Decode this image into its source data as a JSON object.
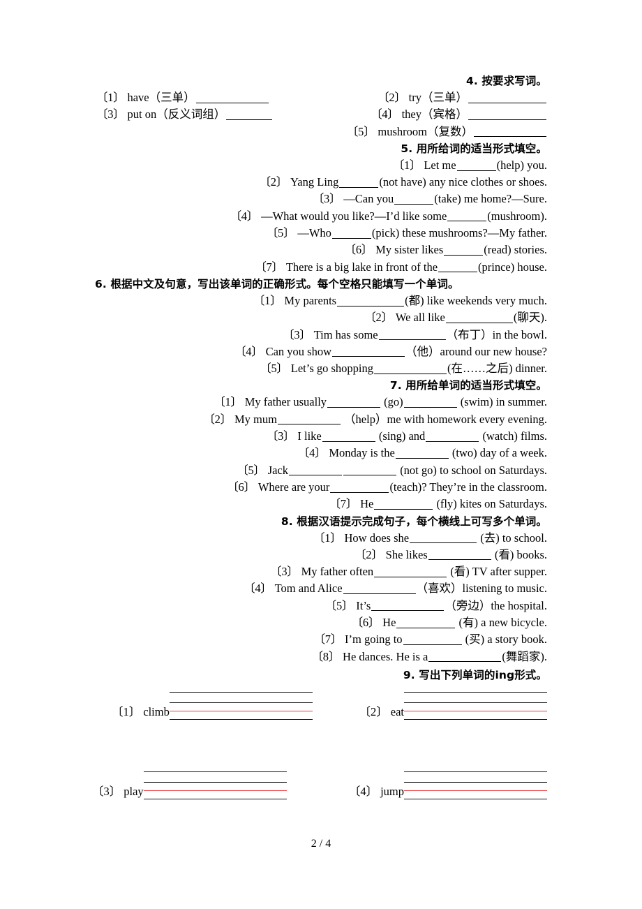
{
  "document": {
    "page_label": "2 / 4",
    "page_number": 2,
    "total_pages": 4
  },
  "sections": [
    {
      "id": "ex4",
      "heading": "4. 按要求写词。",
      "layout": "two-column",
      "items": [
        {
          "index": "〔1〕",
          "text": "have（三单）",
          "blank_width": "w104"
        },
        {
          "index": "〔2〕",
          "text": "try（三单）",
          "blank_width": "w112"
        },
        {
          "index": "〔3〕",
          "text": "put on（反义词组）",
          "blank_width": "w66"
        },
        {
          "index": "〔4〕",
          "text": "they（宾格）",
          "blank_width": "w112"
        },
        {
          "index": "〔5〕",
          "text": "mushroom（复数）",
          "blank_width": "w104"
        }
      ]
    },
    {
      "id": "ex5",
      "heading": "5. 用所给词的适当形式填空。",
      "layout": "right-aligned",
      "items": [
        {
          "index": "〔1〕",
          "before": "Let me",
          "blank_width": "w56",
          "after": "(help) you."
        },
        {
          "index": "〔2〕",
          "before": "Yang Ling",
          "blank_width": "w56",
          "after": "(not have) any nice clothes or shoes."
        },
        {
          "index": "〔3〕",
          "before": "—Can you",
          "blank_width": "w56",
          "after": "(take) me home?—Sure."
        },
        {
          "index": "〔4〕",
          "before": "—What would you like?—I’d like some",
          "blank_width": "w56",
          "after": "(mushroom)."
        },
        {
          "index": "〔5〕",
          "before": "—Who",
          "blank_width": "w56",
          "after": "(pick) these mushrooms?—My father."
        },
        {
          "index": "〔6〕",
          "before": "My sister likes",
          "blank_width": "w56",
          "after": "(read) stories."
        },
        {
          "index": "〔7〕",
          "before": "There is a big lake in front of the",
          "blank_width": "w56",
          "after": "(prince) house."
        }
      ]
    },
    {
      "id": "ex6",
      "heading": "6. 根据中文及句意，写出该单词的正确形式。每个空格只能填写一个单词。",
      "heading_align": "left",
      "layout": "right-aligned",
      "items": [
        {
          "index": "〔1〕",
          "before": "My parents",
          "blank_width": "w96",
          "after": "(都) like weekends very much."
        },
        {
          "index": "〔2〕",
          "before": "We all like",
          "blank_width": "w96",
          "after": "(聊天)."
        },
        {
          "index": "〔3〕",
          "before": "Tim has some",
          "blank_width": "w96",
          "after": "（布丁）in the bowl."
        },
        {
          "index": "〔4〕",
          "before": "Can you show",
          "blank_width": "w104",
          "after": "（他）around our new house?"
        },
        {
          "index": "〔5〕",
          "before": "Let’s go shopping",
          "blank_width": "w104",
          "after": "(在……之后) dinner."
        }
      ]
    },
    {
      "id": "ex7",
      "heading": "7. 用所给单词的适当形式填空。",
      "layout": "right-aligned",
      "items": [
        {
          "index": "〔1〕",
          "before": "My father usually",
          "blank_width": "w76",
          "mid": "(go)",
          "blank2_width": "w76",
          "after": "(swim) in summer."
        },
        {
          "index": "〔2〕",
          "before": "My mum",
          "blank_width": "w90",
          "after": "（help）me with homework every evening."
        },
        {
          "index": "〔3〕",
          "before": "I like",
          "blank_width": "w76",
          "mid": "(sing) and",
          "blank2_width": "w76",
          "after": "(watch) films."
        },
        {
          "index": "〔4〕",
          "before": "Monday is the",
          "blank_width": "w76",
          "after": "(two) day of a week."
        },
        {
          "index": "〔5〕",
          "before": "Jack",
          "blank_width": "w76",
          "mid": "",
          "blank2_width": "w76",
          "after": "(not go) to school on Saturdays."
        },
        {
          "index": "〔6〕",
          "before": "Where are your",
          "blank_width": "w84",
          "after": "(teach)? They’re in the classroom."
        },
        {
          "index": "〔7〕",
          "before": "He",
          "blank_width": "w84",
          "after": "(fly) kites on Saturdays."
        }
      ]
    },
    {
      "id": "ex8",
      "heading": "8. 根据汉语提示完成句子，每个横线上可写多个单词。",
      "layout": "right-aligned",
      "items": [
        {
          "index": "〔1〕",
          "before": "How does she",
          "blank_width": "w96",
          "after": "(去) to school."
        },
        {
          "index": "〔2〕",
          "before": "She likes",
          "blank_width": "w90",
          "after": "(看) books."
        },
        {
          "index": "〔3〕",
          "before": "My father often",
          "blank_width": "w104",
          "after": "(看) TV after supper."
        },
        {
          "index": "〔4〕",
          "before": "Tom and Alice",
          "blank_width": "w104",
          "after": "（喜欢）listening to music."
        },
        {
          "index": "〔5〕",
          "before": "It’s",
          "blank_width": "w104",
          "after": "（旁边）the hospital."
        },
        {
          "index": "〔6〕",
          "before": "He",
          "blank_width": "w84",
          "after": "(有) a new bicycle."
        },
        {
          "index": "〔7〕",
          "before": "I’m going to",
          "blank_width": "w84",
          "after": "(买) a story book."
        },
        {
          "index": "〔8〕",
          "before": "He dances. He is a",
          "blank_width": "w104",
          "after": "(舞蹈家)."
        }
      ]
    },
    {
      "id": "ex9",
      "heading": "9. 写出下列单词的ing形式。",
      "layout": "writing-staves",
      "stave_rows": [
        [
          {
            "index": "〔1〕",
            "word": "climb"
          },
          {
            "index": "〔2〕",
            "word": "eat"
          }
        ],
        [
          {
            "index": "〔3〕",
            "word": "play"
          },
          {
            "index": "〔4〕",
            "word": "jump"
          }
        ]
      ]
    }
  ],
  "colors": {
    "text": "#000000",
    "rule_black": "#111111",
    "rule_red": "#e8393c",
    "page_background": "#ffffff"
  }
}
